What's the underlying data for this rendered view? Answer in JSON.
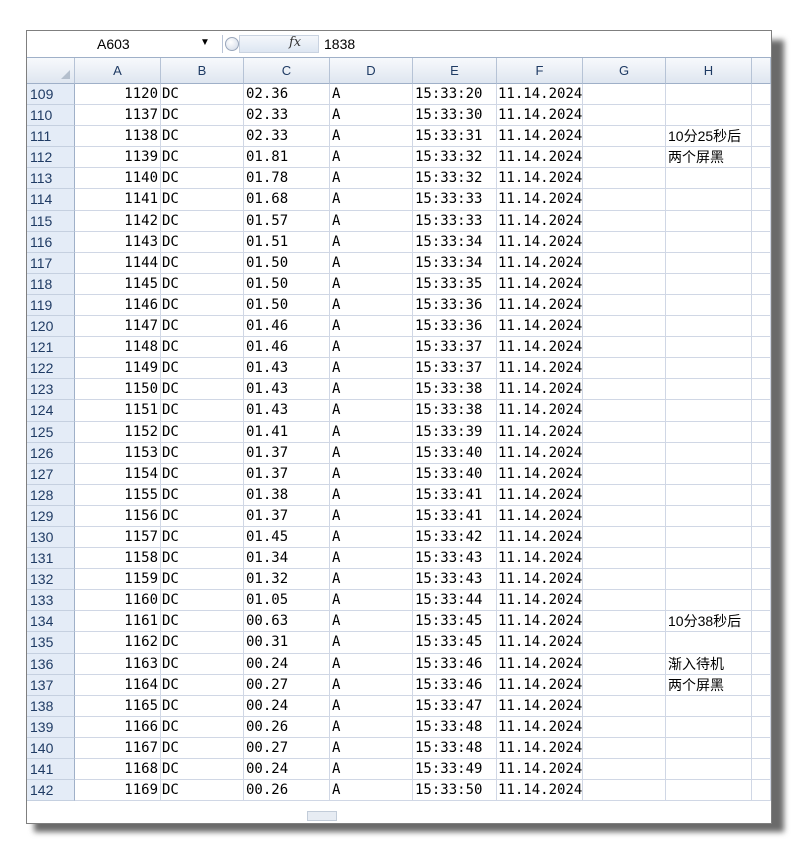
{
  "formula_bar": {
    "name_box": "A603",
    "fx_symbol": "fx",
    "value": "1838"
  },
  "columns": [
    "A",
    "B",
    "C",
    "D",
    "E",
    "F",
    "G",
    "H"
  ],
  "rows": [
    {
      "n": "109",
      "a": "1120",
      "b": "DC",
      "c": "02.36",
      "d": "A",
      "e": "15:33:20",
      "f": "11.14.2024",
      "h": ""
    },
    {
      "n": "110",
      "a": "1137",
      "b": "DC",
      "c": "02.33",
      "d": "A",
      "e": "15:33:30",
      "f": "11.14.2024",
      "h": ""
    },
    {
      "n": "111",
      "a": "1138",
      "b": "DC",
      "c": "02.33",
      "d": "A",
      "e": "15:33:31",
      "f": "11.14.2024",
      "h": "10分25秒后"
    },
    {
      "n": "112",
      "a": "1139",
      "b": "DC",
      "c": "01.81",
      "d": "A",
      "e": "15:33:32",
      "f": "11.14.2024",
      "h": "两个屏黑"
    },
    {
      "n": "113",
      "a": "1140",
      "b": "DC",
      "c": "01.78",
      "d": "A",
      "e": "15:33:32",
      "f": "11.14.2024",
      "h": ""
    },
    {
      "n": "114",
      "a": "1141",
      "b": "DC",
      "c": "01.68",
      "d": "A",
      "e": "15:33:33",
      "f": "11.14.2024",
      "h": ""
    },
    {
      "n": "115",
      "a": "1142",
      "b": "DC",
      "c": "01.57",
      "d": "A",
      "e": "15:33:33",
      "f": "11.14.2024",
      "h": ""
    },
    {
      "n": "116",
      "a": "1143",
      "b": "DC",
      "c": "01.51",
      "d": "A",
      "e": "15:33:34",
      "f": "11.14.2024",
      "h": ""
    },
    {
      "n": "117",
      "a": "1144",
      "b": "DC",
      "c": "01.50",
      "d": "A",
      "e": "15:33:34",
      "f": "11.14.2024",
      "h": ""
    },
    {
      "n": "118",
      "a": "1145",
      "b": "DC",
      "c": "01.50",
      "d": "A",
      "e": "15:33:35",
      "f": "11.14.2024",
      "h": ""
    },
    {
      "n": "119",
      "a": "1146",
      "b": "DC",
      "c": "01.50",
      "d": "A",
      "e": "15:33:36",
      "f": "11.14.2024",
      "h": ""
    },
    {
      "n": "120",
      "a": "1147",
      "b": "DC",
      "c": "01.46",
      "d": "A",
      "e": "15:33:36",
      "f": "11.14.2024",
      "h": ""
    },
    {
      "n": "121",
      "a": "1148",
      "b": "DC",
      "c": "01.46",
      "d": "A",
      "e": "15:33:37",
      "f": "11.14.2024",
      "h": ""
    },
    {
      "n": "122",
      "a": "1149",
      "b": "DC",
      "c": "01.43",
      "d": "A",
      "e": "15:33:37",
      "f": "11.14.2024",
      "h": ""
    },
    {
      "n": "123",
      "a": "1150",
      "b": "DC",
      "c": "01.43",
      "d": "A",
      "e": "15:33:38",
      "f": "11.14.2024",
      "h": ""
    },
    {
      "n": "124",
      "a": "1151",
      "b": "DC",
      "c": "01.43",
      "d": "A",
      "e": "15:33:38",
      "f": "11.14.2024",
      "h": ""
    },
    {
      "n": "125",
      "a": "1152",
      "b": "DC",
      "c": "01.41",
      "d": "A",
      "e": "15:33:39",
      "f": "11.14.2024",
      "h": ""
    },
    {
      "n": "126",
      "a": "1153",
      "b": "DC",
      "c": "01.37",
      "d": "A",
      "e": "15:33:40",
      "f": "11.14.2024",
      "h": ""
    },
    {
      "n": "127",
      "a": "1154",
      "b": "DC",
      "c": "01.37",
      "d": "A",
      "e": "15:33:40",
      "f": "11.14.2024",
      "h": ""
    },
    {
      "n": "128",
      "a": "1155",
      "b": "DC",
      "c": "01.38",
      "d": "A",
      "e": "15:33:41",
      "f": "11.14.2024",
      "h": ""
    },
    {
      "n": "129",
      "a": "1156",
      "b": "DC",
      "c": "01.37",
      "d": "A",
      "e": "15:33:41",
      "f": "11.14.2024",
      "h": ""
    },
    {
      "n": "130",
      "a": "1157",
      "b": "DC",
      "c": "01.45",
      "d": "A",
      "e": "15:33:42",
      "f": "11.14.2024",
      "h": ""
    },
    {
      "n": "131",
      "a": "1158",
      "b": "DC",
      "c": "01.34",
      "d": "A",
      "e": "15:33:43",
      "f": "11.14.2024",
      "h": ""
    },
    {
      "n": "132",
      "a": "1159",
      "b": "DC",
      "c": "01.32",
      "d": "A",
      "e": "15:33:43",
      "f": "11.14.2024",
      "h": ""
    },
    {
      "n": "133",
      "a": "1160",
      "b": "DC",
      "c": "01.05",
      "d": "A",
      "e": "15:33:44",
      "f": "11.14.2024",
      "h": ""
    },
    {
      "n": "134",
      "a": "1161",
      "b": "DC",
      "c": "00.63",
      "d": "A",
      "e": "15:33:45",
      "f": "11.14.2024",
      "h": "10分38秒后"
    },
    {
      "n": "135",
      "a": "1162",
      "b": "DC",
      "c": "00.31",
      "d": "A",
      "e": "15:33:45",
      "f": "11.14.2024",
      "h": ""
    },
    {
      "n": "136",
      "a": "1163",
      "b": "DC",
      "c": "00.24",
      "d": "A",
      "e": "15:33:46",
      "f": "11.14.2024",
      "h": "渐入待机"
    },
    {
      "n": "137",
      "a": "1164",
      "b": "DC",
      "c": "00.27",
      "d": "A",
      "e": "15:33:46",
      "f": "11.14.2024",
      "h": "两个屏黑"
    },
    {
      "n": "138",
      "a": "1165",
      "b": "DC",
      "c": "00.24",
      "d": "A",
      "e": "15:33:47",
      "f": "11.14.2024",
      "h": ""
    },
    {
      "n": "139",
      "a": "1166",
      "b": "DC",
      "c": "00.26",
      "d": "A",
      "e": "15:33:48",
      "f": "11.14.2024",
      "h": ""
    },
    {
      "n": "140",
      "a": "1167",
      "b": "DC",
      "c": "00.27",
      "d": "A",
      "e": "15:33:48",
      "f": "11.14.2024",
      "h": ""
    },
    {
      "n": "141",
      "a": "1168",
      "b": "DC",
      "c": "00.24",
      "d": "A",
      "e": "15:33:49",
      "f": "11.14.2024",
      "h": ""
    },
    {
      "n": "142",
      "a": "1169",
      "b": "DC",
      "c": "00.26",
      "d": "A",
      "e": "15:33:50",
      "f": "11.14.2024",
      "h": ""
    }
  ]
}
